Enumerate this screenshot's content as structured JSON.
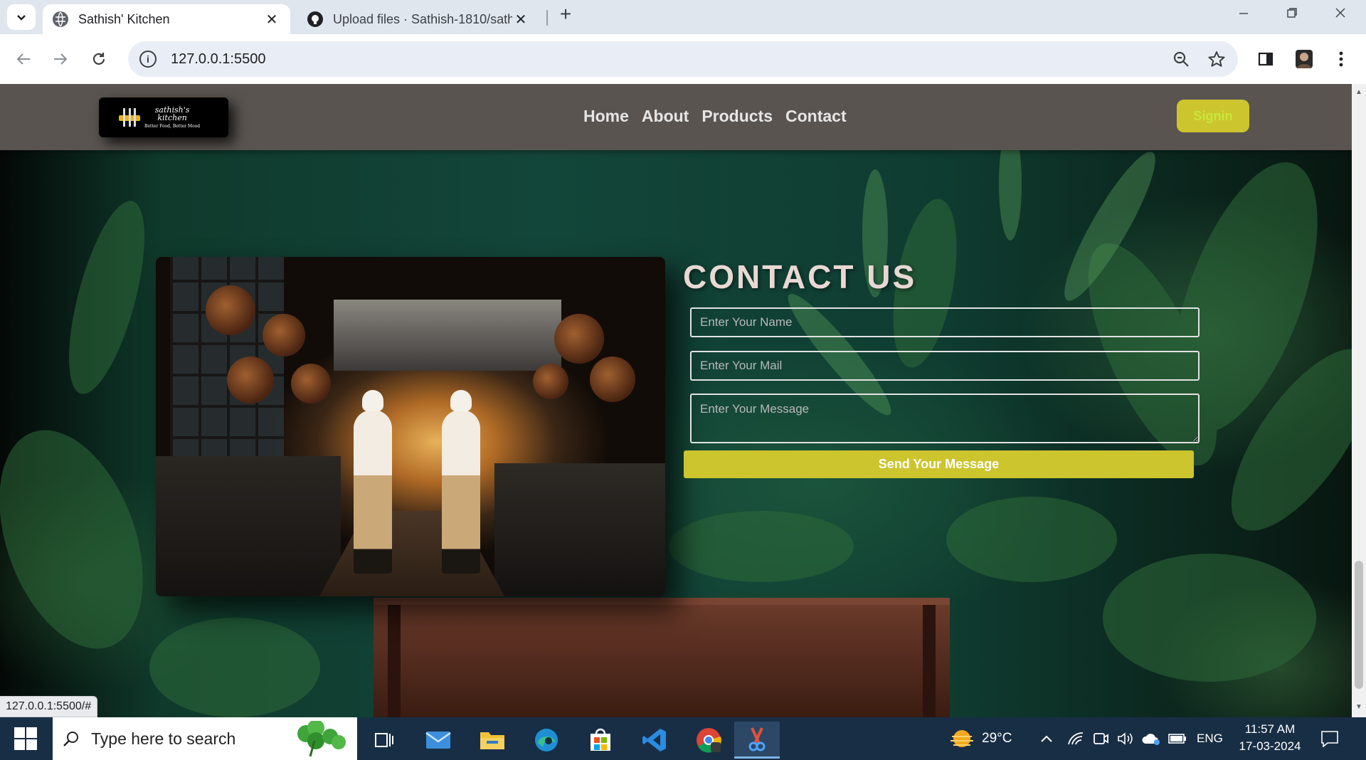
{
  "browser": {
    "tabs": [
      {
        "title": "Sathish' Kitchen",
        "active": true
      },
      {
        "title": "Upload files · Sathish-1810/sath",
        "active": false
      }
    ],
    "url": "127.0.0.1:5500",
    "status_url": "127.0.0.1:5500/#"
  },
  "site": {
    "logo": {
      "name_line1": "sathish's",
      "name_line2": "kitchen",
      "tagline": "Better Food, Better Mood"
    },
    "menu": [
      "Home",
      "About",
      "Products",
      "Contact"
    ],
    "signin_label": "Signin",
    "contact": {
      "title": "CONTACT US",
      "name_placeholder": "Enter Your Name",
      "mail_placeholder": "Enter Your Mail",
      "message_placeholder": "Enter Your Message",
      "send_label": "Send Your Message"
    }
  },
  "taskbar": {
    "search_placeholder": "Type here to search",
    "weather": "29°C",
    "language": "ENG",
    "time": "11:57 AM",
    "date": "17-03-2024"
  },
  "colors": {
    "accent_yellow": "#cdc52e",
    "nav_bg": "#5a5450",
    "taskbar_bg": "#182e45"
  }
}
